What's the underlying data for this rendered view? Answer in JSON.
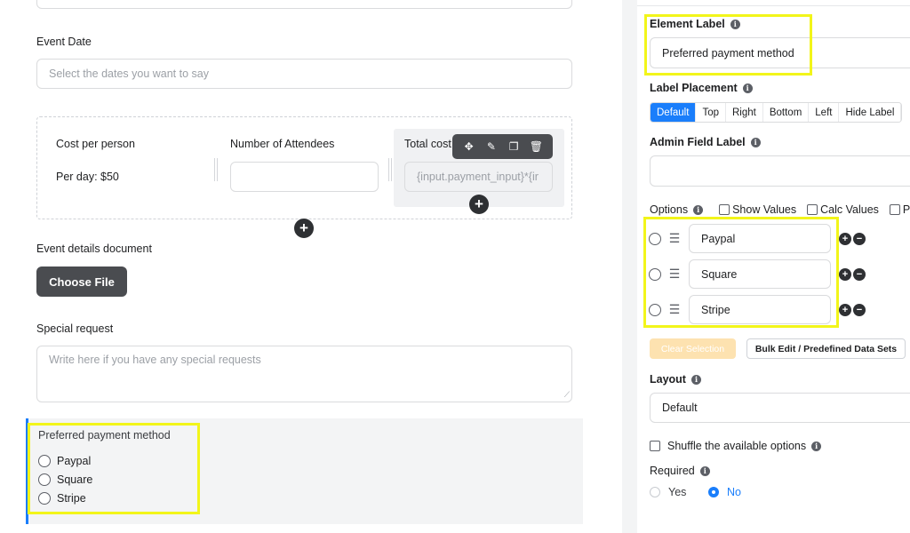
{
  "form": {
    "event_date_label": "Event Date",
    "event_date_placeholder": "Select the dates you want to say",
    "cost_per_person_label": "Cost per person",
    "cost_per_person_value": "Per day: $50",
    "attendees_label": "Number of Attendees",
    "total_cost_label": "Total cost",
    "total_cost_formula": "{input.payment_input}*{ir",
    "toolbar_icons": [
      "move-icon",
      "edit-icon",
      "duplicate-icon",
      "delete-icon"
    ],
    "details_doc_label": "Event details document",
    "choose_file": "Choose File",
    "special_request_label": "Special request",
    "special_request_placeholder": "Write here if you have any special requests",
    "payment_label": "Preferred payment method",
    "payment_options": [
      "Paypal",
      "Square",
      "Stripe"
    ]
  },
  "settings": {
    "element_label_title": "Element Label",
    "element_label_value": "Preferred payment method",
    "label_placement_title": "Label Placement",
    "placements": [
      "Default",
      "Top",
      "Right",
      "Bottom",
      "Left",
      "Hide Label"
    ],
    "admin_field_label_title": "Admin Field Label",
    "options_title": "Options",
    "show_values": "Show Values",
    "calc_values": "Calc Values",
    "extra_check": "P",
    "options": [
      "Paypal",
      "Square",
      "Stripe"
    ],
    "clear_selection": "Clear Selection",
    "bulk_edit": "Bulk Edit / Predefined Data Sets",
    "layout_title": "Layout",
    "layout_value": "Default",
    "shuffle_label": "Shuffle the available options",
    "required_title": "Required",
    "required_yes": "Yes",
    "required_no": "No"
  },
  "colors": {
    "accent": "#1a7efb",
    "highlight": "#f2f51a",
    "dark_button": "#4a4c50"
  }
}
